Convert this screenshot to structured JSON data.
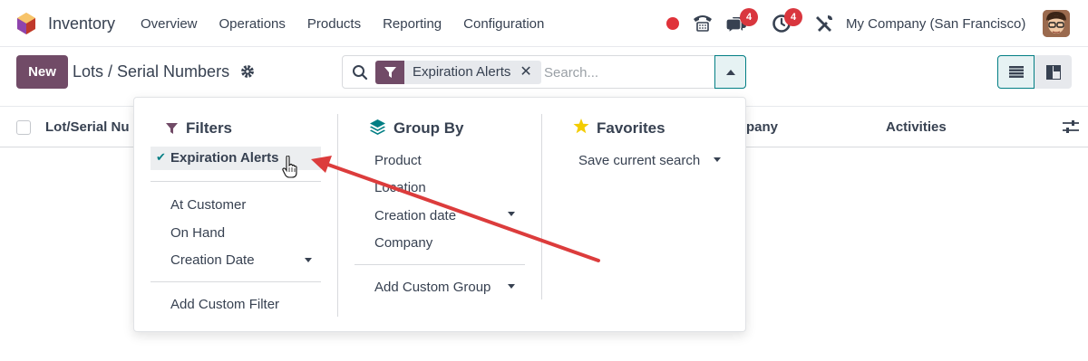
{
  "navbar": {
    "app_name": "Inventory",
    "menu": [
      "Overview",
      "Operations",
      "Products",
      "Reporting",
      "Configuration"
    ],
    "chat_badge": "4",
    "activity_badge": "4",
    "company": "My Company (San Francisco)"
  },
  "control_panel": {
    "new_label": "New",
    "breadcrumb": "Lots / Serial Numbers",
    "facet_label": "Expiration Alerts",
    "facet_close": "✕",
    "search_placeholder": "Search..."
  },
  "list_header": {
    "col_lot": "Lot/Serial Nu",
    "col_company": "pany",
    "col_activities": "Activities"
  },
  "dropdown": {
    "filters": {
      "title": "Filters",
      "active_item": "Expiration Alerts",
      "check": "✔",
      "items": [
        "At Customer",
        "On Hand",
        "Creation Date"
      ],
      "add_custom": "Add Custom Filter"
    },
    "group_by": {
      "title": "Group By",
      "items": [
        "Product",
        "Location",
        "Creation date",
        "Company"
      ],
      "add_custom": "Add Custom Group"
    },
    "favorites": {
      "title": "Favorites",
      "save_search": "Save current search"
    }
  },
  "colors": {
    "brand": "#714b67",
    "accent": "#017e84",
    "badge": "#d9363e",
    "annotation_arrow": "#dc3c3c"
  }
}
